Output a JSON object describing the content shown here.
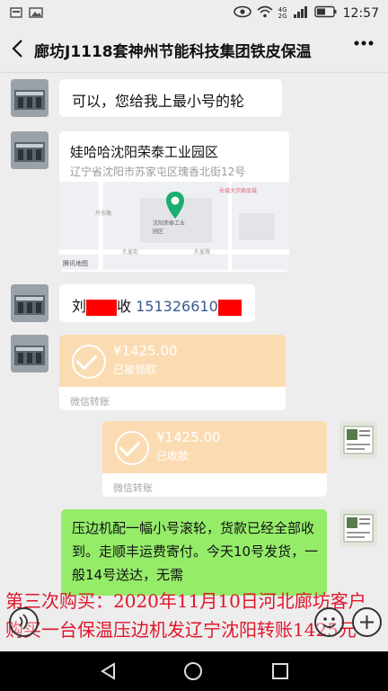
{
  "status_bar": {
    "network": "4G 2G",
    "time": "12:57"
  },
  "chat": {
    "title": "廊坊J1118套神州节能科技集团铁皮保温"
  },
  "messages": {
    "m1": {
      "text": "可以，您给我上最小号的轮"
    },
    "location": {
      "name": "娃哈哈沈阳荣泰工业园区",
      "address": "辽宁省沈阳市苏家屯区瑰香北街12号",
      "map_labels": [
        "沈阳荣泰工业园区",
        "长城大宗商品城",
        "丹东路",
        "孔雀街",
        "孔雀路",
        "腾讯地图"
      ]
    },
    "m3": {
      "prefix": "刘",
      "mid": "收",
      "phone": "151326610"
    },
    "transfer_received": {
      "amount": "¥1425.00",
      "status": "已被领取",
      "footer": "微信转账"
    },
    "transfer_sent": {
      "amount": "¥1425.00",
      "status": "已收款",
      "footer": "微信转账"
    },
    "m6": {
      "text": "压边机配一幅小号滚轮，货款已经全部收到。走顺丰运费寄付。今天10号发货，一般14号送达，无需"
    }
  },
  "caption": {
    "line1": "第三次购买：2020年11月10日河北廊坊客户",
    "line2": "购买一台保温压边机发辽宁沈阳转账1425元"
  },
  "colors": {
    "bubble_green": "#95ec69",
    "transfer_orange": "#fbdcb2",
    "caption_red": "#e0162b"
  },
  "icons": [
    "eye-icon",
    "wifi-icon",
    "signal-icon",
    "battery-icon",
    "back-icon",
    "more-icon",
    "voice-icon",
    "emoji-icon",
    "plus-icon",
    "nav-back-icon",
    "nav-home-icon",
    "nav-recent-icon"
  ]
}
